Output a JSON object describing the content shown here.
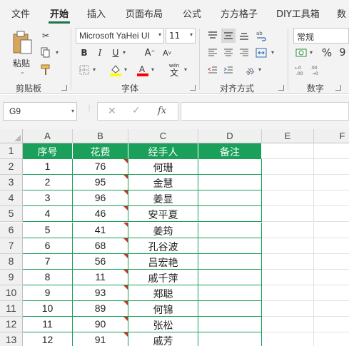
{
  "ribbon_tabs": [
    "文件",
    "开始",
    "插入",
    "页面布局",
    "公式",
    "方方格子",
    "DIY工具箱",
    "数"
  ],
  "active_tab": "开始",
  "clipboard": {
    "paste_label": "粘贴",
    "group_label": "剪贴板"
  },
  "font": {
    "name": "Microsoft YaHei UI",
    "size": "11",
    "group_label": "字体",
    "bold": "B",
    "italic": "I",
    "underline": "U",
    "grow": "A",
    "shrink": "A",
    "wen": "wén",
    "wen_char": "文"
  },
  "alignment": {
    "group_label": "对齐方式"
  },
  "number": {
    "format": "常规",
    "group_label": "数字",
    "percent": "%",
    "comma": "9"
  },
  "formula_bar": {
    "name_box": "G9",
    "fx": "fx",
    "formula": ""
  },
  "columns": [
    "A",
    "B",
    "C",
    "D",
    "E",
    "F"
  ],
  "rows": [
    "1",
    "2",
    "3",
    "4",
    "5",
    "6",
    "7",
    "8",
    "9",
    "10",
    "11",
    "12",
    "13"
  ],
  "table": {
    "headers": [
      "序号",
      "花费",
      "经手人",
      "备注"
    ],
    "records": [
      [
        "1",
        "76",
        "何珊",
        ""
      ],
      [
        "2",
        "95",
        "金慧",
        ""
      ],
      [
        "3",
        "96",
        "姜显",
        ""
      ],
      [
        "4",
        "46",
        "安平夏",
        ""
      ],
      [
        "5",
        "41",
        "姜筠",
        ""
      ],
      [
        "6",
        "68",
        "孔谷波",
        ""
      ],
      [
        "7",
        "56",
        "吕宏艳",
        ""
      ],
      [
        "8",
        "11",
        "戚千萍",
        ""
      ],
      [
        "9",
        "93",
        "郑聪",
        ""
      ],
      [
        "10",
        "89",
        "何锦",
        ""
      ],
      [
        "11",
        "90",
        "张松",
        ""
      ],
      [
        "12",
        "91",
        "戚芳",
        ""
      ]
    ]
  },
  "colors": {
    "header_fill": "#1aa05a",
    "comment_marker": "#c0392b",
    "highlight_yellow": "#ffff00",
    "font_red": "#ff0000",
    "tab_accent": "#217346"
  }
}
